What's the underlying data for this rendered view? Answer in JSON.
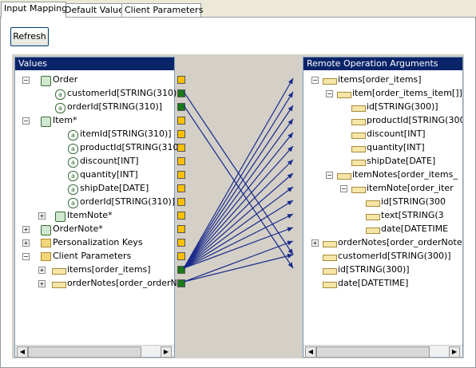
{
  "tabs": [
    "Input Mapping",
    "Default Values",
    "Client Parameters"
  ],
  "refresh_label": "Refresh",
  "left_panel": {
    "title": "Values",
    "rows": [
      {
        "label": "Order",
        "icon": "phone-icon",
        "exp": "−",
        "port": "y"
      },
      {
        "label": "customerId[STRING(310)]",
        "icon": "attribute-icon",
        "exp": "",
        "port": "g"
      },
      {
        "label": "orderId[STRING(310)]",
        "icon": "attribute-icon",
        "exp": "",
        "port": "g"
      },
      {
        "label": "Item*",
        "icon": "phone-icon",
        "exp": "−",
        "port": "y"
      },
      {
        "label": "itemId[STRING(310)]",
        "icon": "attribute-icon",
        "exp": "",
        "port": "y"
      },
      {
        "label": "productId[STRING(310",
        "icon": "attribute-icon",
        "exp": "",
        "port": "y"
      },
      {
        "label": "discount[INT]",
        "icon": "attribute-icon",
        "exp": "",
        "port": "y"
      },
      {
        "label": "quantity[INT]",
        "icon": "attribute-icon",
        "exp": "",
        "port": "y"
      },
      {
        "label": "shipDate[DATE]",
        "icon": "attribute-icon",
        "exp": "",
        "port": "y"
      },
      {
        "label": "orderId[STRING(310)]",
        "icon": "attribute-icon",
        "exp": "",
        "port": "y"
      },
      {
        "label": "ItemNote*",
        "icon": "phone-icon",
        "exp": "+",
        "port": "y"
      },
      {
        "label": "OrderNote*",
        "icon": "phone-icon",
        "exp": "+",
        "port": "y"
      },
      {
        "label": "Personalization Keys",
        "icon": "folder-icon",
        "exp": "+",
        "port": "y"
      },
      {
        "label": "Client Parameters",
        "icon": "folder-icon",
        "exp": "−",
        "port": "y"
      },
      {
        "label": "items[order_items]",
        "icon": "array-icon",
        "exp": "+",
        "port": "g"
      },
      {
        "label": "orderNotes[order_orderNo",
        "icon": "array-icon",
        "exp": "+",
        "port": "g"
      }
    ]
  },
  "right_panel": {
    "title": "Remote Operation Arguments",
    "rows": [
      {
        "label": "items[order_items]",
        "exp": "−",
        "port": "g"
      },
      {
        "label": "item[order_items_item[]]",
        "exp": "−",
        "port": "g"
      },
      {
        "label": "id[STRING(300)]",
        "exp": "",
        "port": "g"
      },
      {
        "label": "productId[STRING(300",
        "exp": "",
        "port": "g"
      },
      {
        "label": "discount[INT]",
        "exp": "",
        "port": "g"
      },
      {
        "label": "quantity[INT]",
        "exp": "",
        "port": "g"
      },
      {
        "label": "shipDate[DATE]",
        "exp": "",
        "port": "g"
      },
      {
        "label": "itemNotes[order_items_",
        "exp": "−",
        "port": "g"
      },
      {
        "label": "itemNote[order_iter",
        "exp": "−",
        "port": "g"
      },
      {
        "label": "id[STRING(300",
        "exp": "",
        "port": "g"
      },
      {
        "label": "text[STRING(3",
        "exp": "",
        "port": "g"
      },
      {
        "label": "date[DATETIME",
        "exp": "",
        "port": "g"
      },
      {
        "label": "orderNotes[order_orderNotes]",
        "exp": "+",
        "port": "g"
      },
      {
        "label": "customerId[STRING(300)]",
        "exp": "",
        "port": "g"
      },
      {
        "label": "id[STRING(300)]",
        "exp": "",
        "port": "g"
      },
      {
        "label": "date[DATETIME]",
        "exp": "",
        "port": "y"
      }
    ]
  },
  "colors": {
    "connector": "#1a2a8a",
    "port_yellow": "#ffc000",
    "port_green": "#1a7a1a",
    "header_bg": "#0a246a"
  }
}
